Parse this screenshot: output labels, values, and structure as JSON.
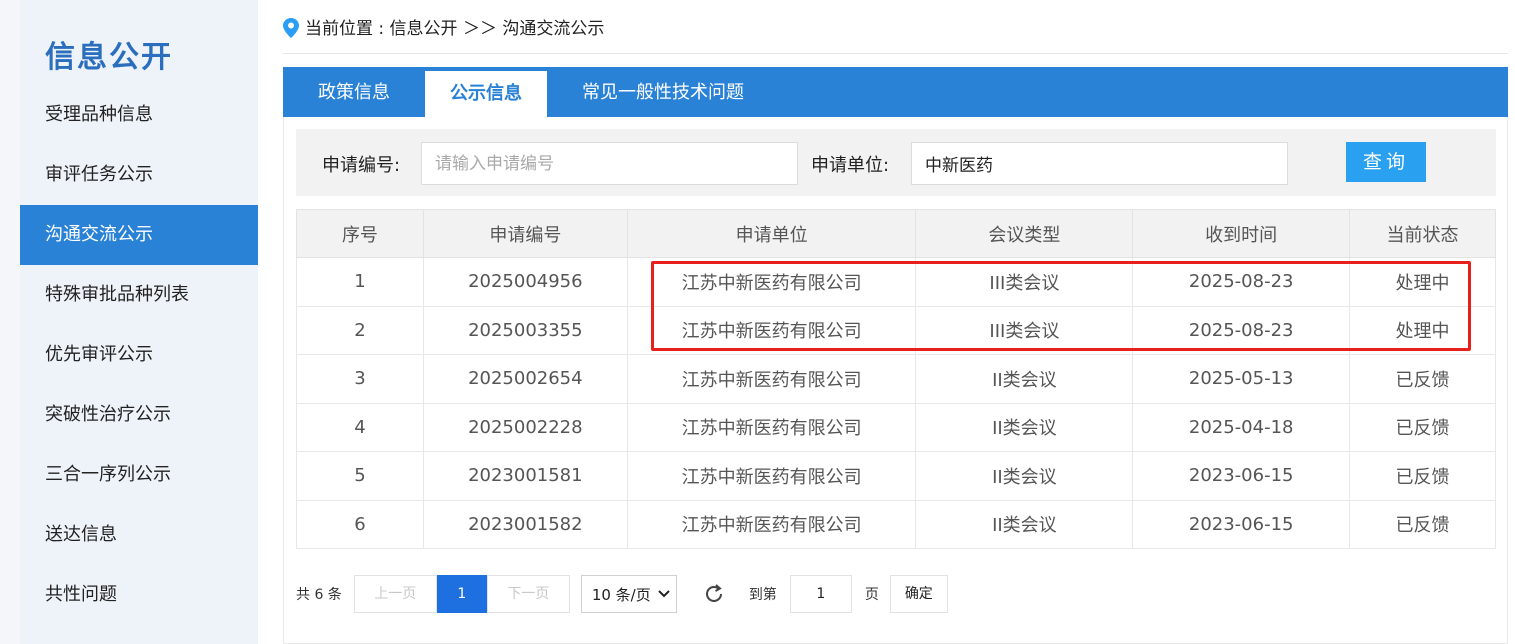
{
  "sidebar": {
    "title": "信息公开",
    "items": [
      {
        "label": "受理品种信息"
      },
      {
        "label": "审评任务公示"
      },
      {
        "label": "沟通交流公示"
      },
      {
        "label": "特殊审批品种列表"
      },
      {
        "label": "优先审评公示"
      },
      {
        "label": "突破性治疗公示"
      },
      {
        "label": "三合一序列公示"
      },
      {
        "label": "送达信息"
      },
      {
        "label": "共性问题"
      }
    ],
    "active_index": 2
  },
  "breadcrumb": {
    "text": "当前位置 : 信息公开 ＞＞ 沟通交流公示"
  },
  "tabs": [
    {
      "label": "政策信息"
    },
    {
      "label": "公示信息"
    },
    {
      "label": "常见一般性技术问题"
    }
  ],
  "search": {
    "app_no_label": "申请编号:",
    "app_no_placeholder": "请输入申请编号",
    "app_no_value": "",
    "unit_label": "申请单位:",
    "unit_value": "中新医药",
    "query_label": "查询"
  },
  "table": {
    "headers": [
      "序号",
      "申请编号",
      "申请单位",
      "会议类型",
      "收到时间",
      "当前状态"
    ],
    "rows": [
      [
        "1",
        "2025004956",
        "江苏中新医药有限公司",
        "III类会议",
        "2025-08-23",
        "处理中"
      ],
      [
        "2",
        "2025003355",
        "江苏中新医药有限公司",
        "III类会议",
        "2025-08-23",
        "处理中"
      ],
      [
        "3",
        "2025002654",
        "江苏中新医药有限公司",
        "II类会议",
        "2025-05-13",
        "已反馈"
      ],
      [
        "4",
        "2025002228",
        "江苏中新医药有限公司",
        "II类会议",
        "2025-04-18",
        "已反馈"
      ],
      [
        "5",
        "2023001581",
        "江苏中新医药有限公司",
        "II类会议",
        "2023-06-15",
        "已反馈"
      ],
      [
        "6",
        "2023001582",
        "江苏中新医药有限公司",
        "II类会议",
        "2023-06-15",
        "已反馈"
      ]
    ]
  },
  "pager": {
    "total": "共 6 条",
    "prev": "上一页",
    "current": "1",
    "next": "下一页",
    "page_size": "10 条/页",
    "goto_label": "到第",
    "goto_value": "1",
    "page_label": "页",
    "confirm": "确定"
  },
  "colors": {
    "accent": "#2a82d6",
    "highlight": "#e8201c"
  }
}
